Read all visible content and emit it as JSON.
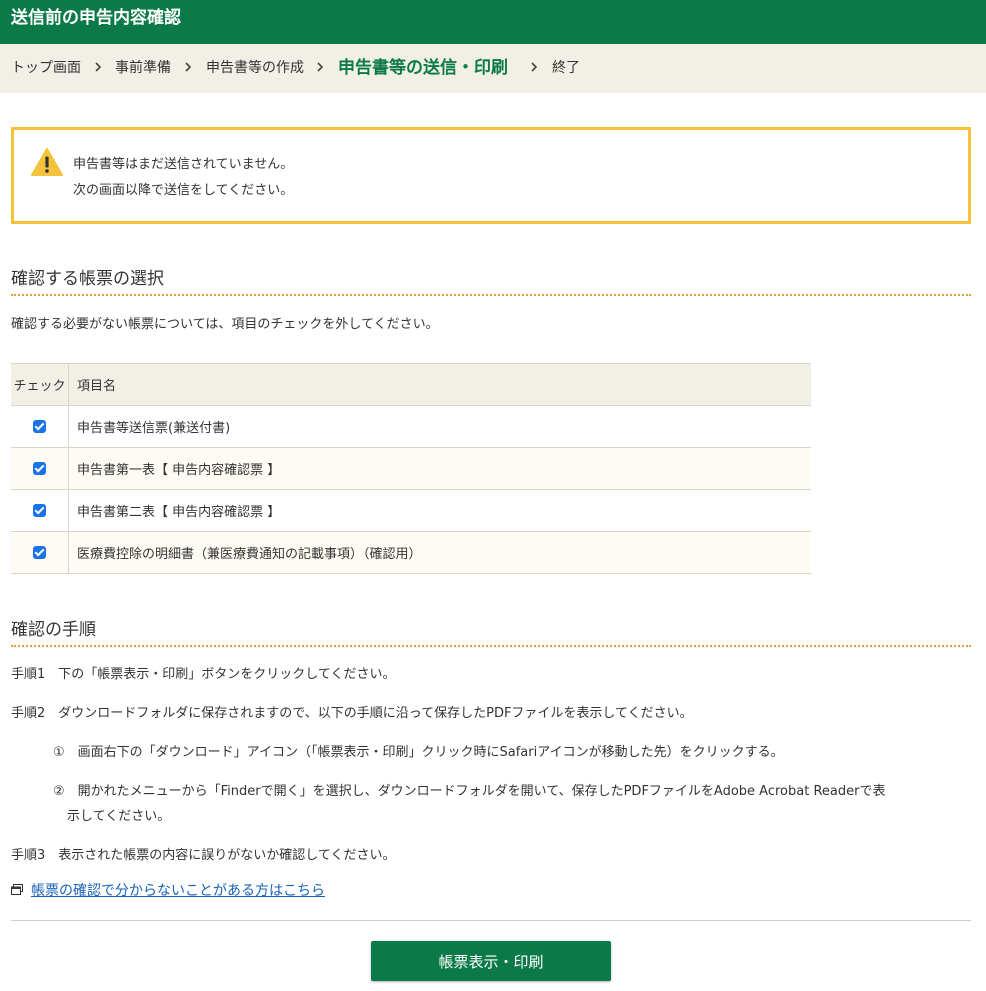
{
  "header": {
    "title": "送信前の申告内容確認"
  },
  "breadcrumb": {
    "items": [
      {
        "label": "トップ画面"
      },
      {
        "label": "事前準備"
      },
      {
        "label": "申告書等の作成"
      },
      {
        "label": "申告書等の送信・印刷"
      },
      {
        "label": "終了"
      }
    ]
  },
  "warning": {
    "line1": "申告書等はまだ送信されていません。",
    "line2": "次の画面以降で送信をしてください。"
  },
  "select_section": {
    "title": "確認する帳票の選択",
    "description": "確認する必要がない帳票については、項目のチェックを外してください。",
    "table": {
      "headers": [
        "チェック",
        "項目名"
      ],
      "rows": [
        {
          "checked": true,
          "name": "申告書等送信票(兼送付書)"
        },
        {
          "checked": true,
          "name": "申告書第一表【 申告内容確認票 】"
        },
        {
          "checked": true,
          "name": "申告書第二表【 申告内容確認票 】"
        },
        {
          "checked": true,
          "name": "医療費控除の明細書（兼医療費通知の記載事項）（確認用）"
        }
      ]
    }
  },
  "procedure_section": {
    "title": "確認の手順",
    "step1": "手順1　下の「帳票表示・印刷」ボタンをクリックしてください。",
    "step2": "手順2　ダウンロードフォルダに保存されますので、以下の手順に沿って保存したPDFファイルを表示してください。",
    "sub1": "①　画面右下の「ダウンロード」アイコン（「帳票表示・印刷」クリック時にSafariアイコンが移動した先）をクリックする。",
    "sub2_line1": "②　開かれたメニューから「Finderで開く」を選択し、ダウンロードフォルダを開いて、保存したPDFファイルをAdobe Acrobat Readerで表",
    "sub2_line2": "示してください。",
    "step3": "手順3　表示された帳票の内容に誤りがないか確認してください。"
  },
  "help_link": {
    "label": "帳票の確認で分からないことがある方はこちら",
    "icon": "new-window-icon"
  },
  "print_button": {
    "label": "帳票表示・印刷"
  },
  "colors": {
    "brand_green": "#0b7a48",
    "warning_border": "#f5c33b",
    "breadcrumb_bg": "#f2efe7",
    "link": "#1a62b8"
  }
}
